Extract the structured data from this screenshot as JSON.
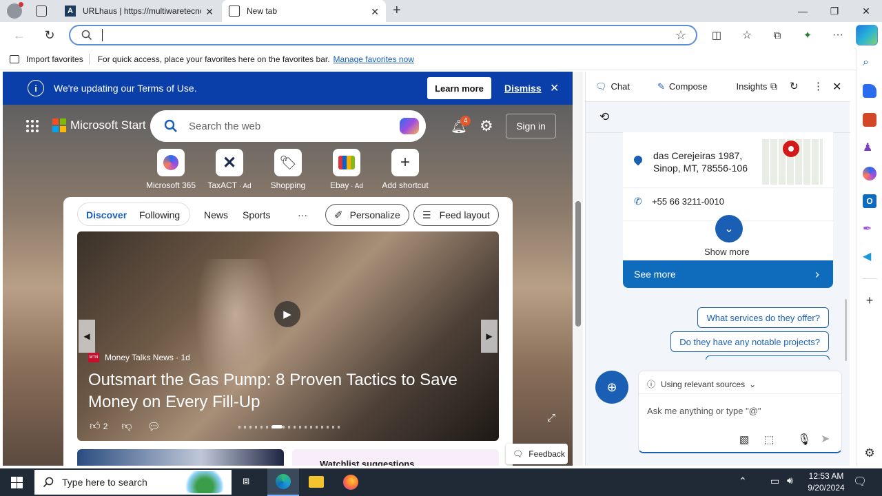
{
  "tabs": [
    {
      "title": "URLhaus | https://multiwaretecnologia.com.br/..."
    },
    {
      "title": "New tab"
    }
  ],
  "address": {
    "value": "",
    "placeholder": ""
  },
  "favbar": {
    "import_label": "Import favorites",
    "hint": "For quick access, place your favorites here on the favorites bar.",
    "manage_link": "Manage favorites now"
  },
  "terms": {
    "message": "We're updating our Terms of Use.",
    "learn_more": "Learn more",
    "dismiss": "Dismiss"
  },
  "start": {
    "brand": "Microsoft Start",
    "search_placeholder": "Search the web",
    "notif_count": "4",
    "signin": "Sign in",
    "shortcuts": [
      {
        "label": "Microsoft 365"
      },
      {
        "label": "TaxACT",
        "ad": "Ad"
      },
      {
        "label": "Shopping"
      },
      {
        "label": "Ebay",
        "ad": "Ad"
      },
      {
        "label": "Add shortcut"
      }
    ],
    "tabs": [
      "Discover",
      "Following",
      "News",
      "Sports"
    ],
    "more": "···",
    "personalize": "Personalize",
    "feed_layout": "Feed layout",
    "hero": {
      "source_badge": "MTN",
      "source": "Money Talks News · 1d",
      "headline": "Outsmart the Gas Pump: 8 Proven Tactics to Save Money on Every Fill-Up",
      "likes": "2"
    },
    "watchlist": "Watchlist suggestions",
    "feedback": "Feedback"
  },
  "copilot": {
    "tabs": {
      "chat": "Chat",
      "compose": "Compose",
      "insights": "Insights"
    },
    "address_line1": "das Cerejeiras 1987,",
    "address_line2": "Sinop, MT, 78556-106",
    "phone": "+55 66 3211-0010",
    "show_more": "Show more",
    "see_more": "See more",
    "suggestions": [
      "What services do they offer?",
      "Do they have any notable projects?"
    ],
    "sources": "Using relevant sources",
    "input_placeholder": "Ask me anything or type \"@\""
  },
  "taskbar": {
    "search_placeholder": "Type here to search",
    "time": "12:53 AM",
    "date": "9/20/2024"
  },
  "colors": {
    "accent": "#0f6cbd",
    "terms_bar": "#0a3ea8",
    "taskbar": "#1f2a36"
  }
}
